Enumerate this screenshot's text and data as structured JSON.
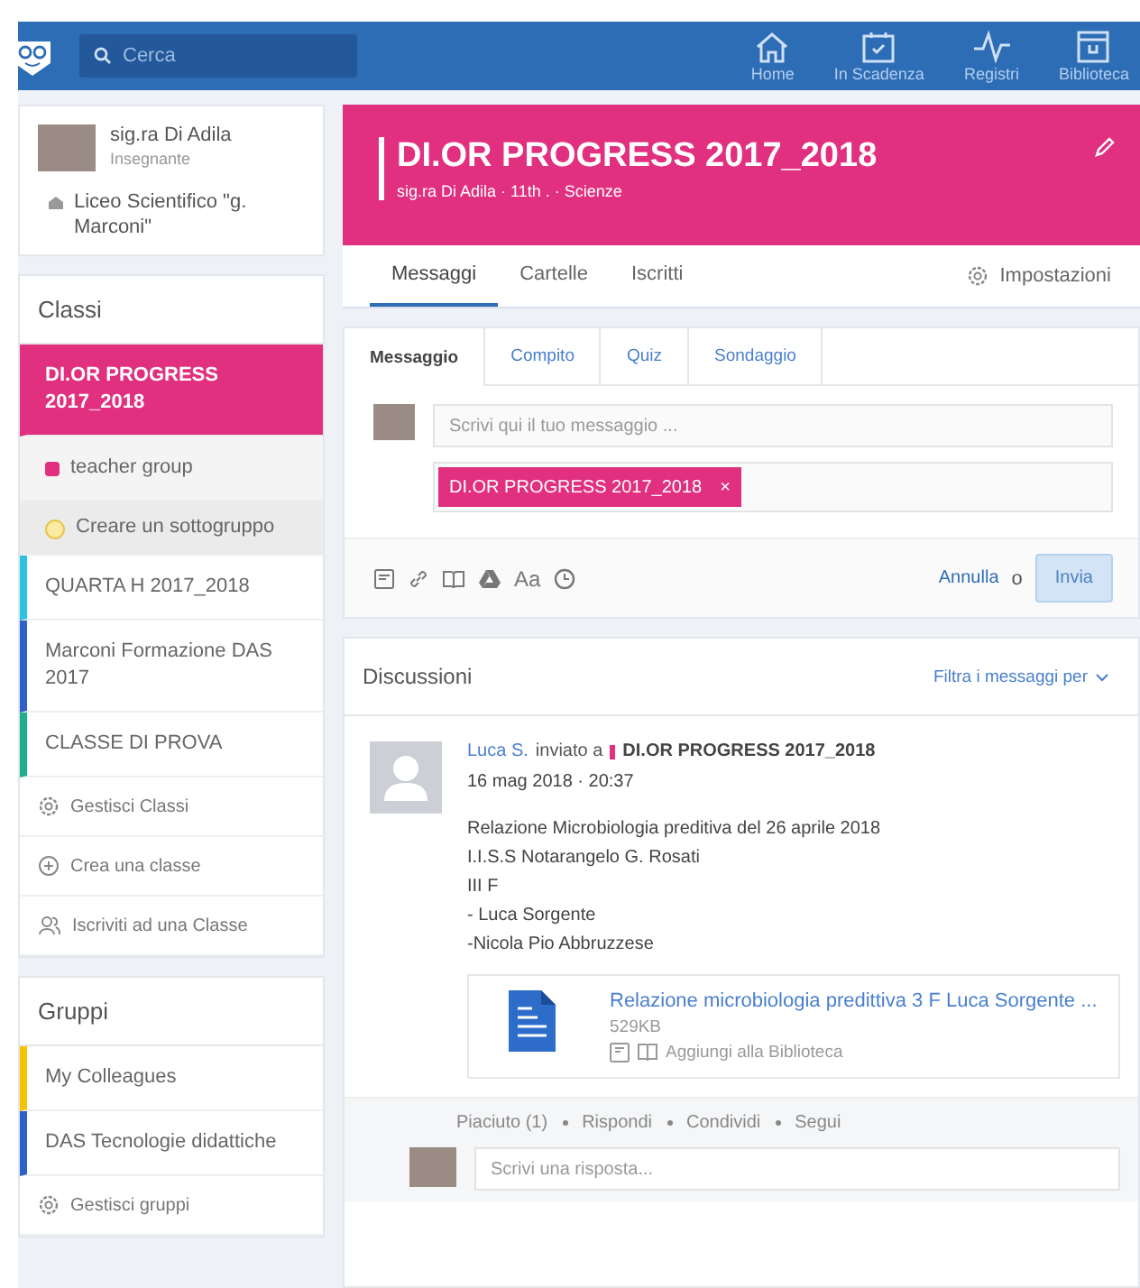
{
  "topbar": {
    "search": {
      "placeholder": "Cerca"
    },
    "nav": [
      {
        "kind": "home",
        "label": "Home"
      },
      {
        "kind": "due",
        "label": "In Scadenza"
      },
      {
        "kind": "pulse",
        "label": "Registri"
      },
      {
        "kind": "library",
        "label": "Biblioteca"
      }
    ]
  },
  "profile": {
    "name": "sig.ra Di Adila",
    "role": "Insegnante",
    "school": "Liceo Scientifico \"g. Marconi\""
  },
  "classes": {
    "title": "Classi",
    "items": [
      {
        "label": "DI.OR PROGRESS 2017_2018",
        "color": "#e0307f",
        "selected": true
      },
      {
        "label": "teacher group",
        "kind": "subgroup",
        "color": "#e0307f"
      },
      {
        "label": "Creare un sottogruppo",
        "kind": "create-subgroup"
      },
      {
        "label": "QUARTA H 2017_2018",
        "color": "#2bc4e0",
        "selected": false
      },
      {
        "label": "Marconi Formazione DAS 2017",
        "color": "#2f5fc9",
        "selected": false
      },
      {
        "label": "CLASSE DI PROVA",
        "color": "#1fae8c",
        "selected": false
      }
    ],
    "actions": [
      {
        "kind": "gear",
        "label": "Gestisci Classi"
      },
      {
        "kind": "plus",
        "label": "Crea una classe"
      },
      {
        "kind": "people",
        "label": "Iscriviti ad una Classe"
      }
    ]
  },
  "groups": {
    "title": "Gruppi",
    "items": [
      {
        "label": "My Colleagues",
        "color": "#f5c400",
        "selected": false
      },
      {
        "label": "DAS Tecnologie didattiche",
        "color": "#2f5fc9",
        "selected": false
      }
    ],
    "actions": [
      {
        "kind": "gear",
        "label": "Gestisci gruppi"
      }
    ]
  },
  "class_header": {
    "title": "DI.OR PROGRESS 2017_2018",
    "subtitle": "sig.ra Di Adila · 11th . · Scienze"
  },
  "tabs": [
    {
      "label": "Messaggi",
      "selected": true
    },
    {
      "label": "Cartelle",
      "selected": false
    },
    {
      "label": "Iscritti",
      "selected": false
    }
  ],
  "settings": "Impostazioni",
  "composer": {
    "tabs": [
      {
        "label": "Messaggio",
        "selected": true
      },
      {
        "label": "Compito",
        "selected": false
      },
      {
        "label": "Quiz",
        "selected": false
      },
      {
        "label": "Sondaggio",
        "selected": false
      }
    ],
    "placeholder": "Scrivi qui il tuo messaggio ...",
    "recipient": "DI.OR PROGRESS 2017_2018",
    "recipient_remove": "×",
    "format_label": "Aa",
    "cancel": "Annulla",
    "or": "o",
    "send": {
      "label": "Invia",
      "disabled": true
    }
  },
  "discussions": {
    "title": "Discussioni",
    "filter": "Filtra i messaggi per",
    "post": {
      "author": "Luca S.",
      "sent_to": "inviato a",
      "group": "DI.OR PROGRESS 2017_2018",
      "date": "16 mag 2018 · 20:37",
      "lines": [
        "Relazione Microbiologia preditiva del 26 aprile 2018",
        "I.I.S.S Notarangelo G. Rosati",
        "III F",
        "- Luca Sorgente",
        "-Nicola Pio Abbruzzese"
      ],
      "attachment": {
        "title": "Relazione microbiologia predittiva 3 F Luca Sorgente ...",
        "size": "529KB",
        "action": "Aggiungi alla Biblioteca"
      },
      "actions": [
        "Piaciuto (1)",
        "Rispondi",
        "Condividi",
        "Segui"
      ],
      "reply_placeholder": "Scrivi una risposta..."
    }
  }
}
